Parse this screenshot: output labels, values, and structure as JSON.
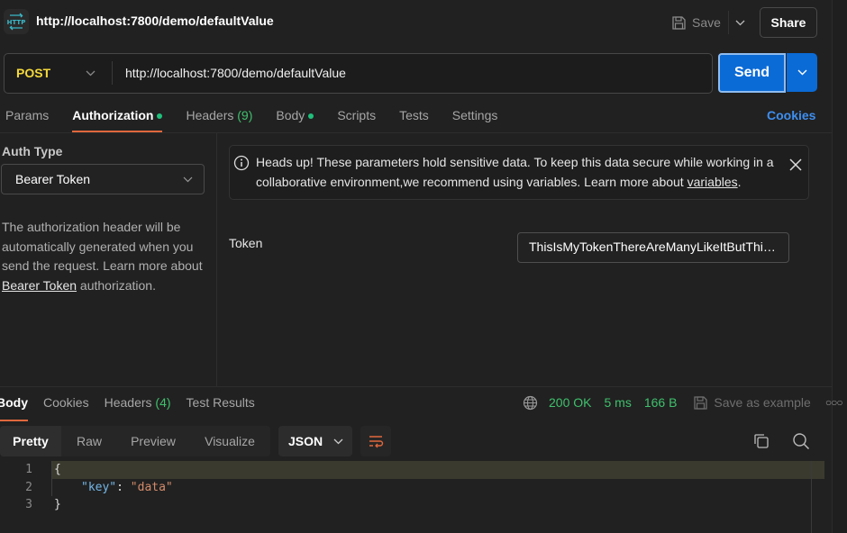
{
  "header": {
    "icon": "http-icon",
    "title": "http://localhost:7800/demo/defaultValue",
    "save_label": "Save",
    "share_label": "Share"
  },
  "request": {
    "method": "POST",
    "url": "http://localhost:7800/demo/defaultValue",
    "send_label": "Send"
  },
  "tabs": {
    "params": "Params",
    "authorization": "Authorization",
    "headers": "Headers",
    "headers_count": "(9)",
    "body": "Body",
    "scripts": "Scripts",
    "tests": "Tests",
    "settings": "Settings",
    "cookies": "Cookies",
    "active": "Authorization"
  },
  "auth": {
    "type_label": "Auth Type",
    "type_value": "Bearer Token",
    "desc_part1": "The authorization header will be automatically generated when you send the request. Learn more about ",
    "desc_link": "Bearer Token",
    "desc_part2": " authorization."
  },
  "alert": {
    "text": "Heads up! These parameters hold sensitive data. To keep this data secure while working in a collaborative environment,we recommend using variables. Learn more about ",
    "link": "variables",
    "end": "."
  },
  "token": {
    "label": "Token",
    "value": "ThisIsMyTokenThereAreManyLikeItButThisOneIsMine"
  },
  "response": {
    "tabs": {
      "body": "Body",
      "cookies": "Cookies",
      "headers": "Headers",
      "headers_count": "(4)",
      "test_results": "Test Results"
    },
    "status": "200 OK",
    "time": "5 ms",
    "size": "166 B",
    "save_example": "Save as example",
    "views": [
      "Pretty",
      "Raw",
      "Preview",
      "Visualize"
    ],
    "active_view": "Pretty",
    "format": "JSON",
    "code": [
      {
        "n": "1",
        "text": "{"
      },
      {
        "n": "2",
        "key": "\"key\"",
        "sep": ": ",
        "value": "\"data\""
      },
      {
        "n": "3",
        "text": "}"
      }
    ]
  }
}
